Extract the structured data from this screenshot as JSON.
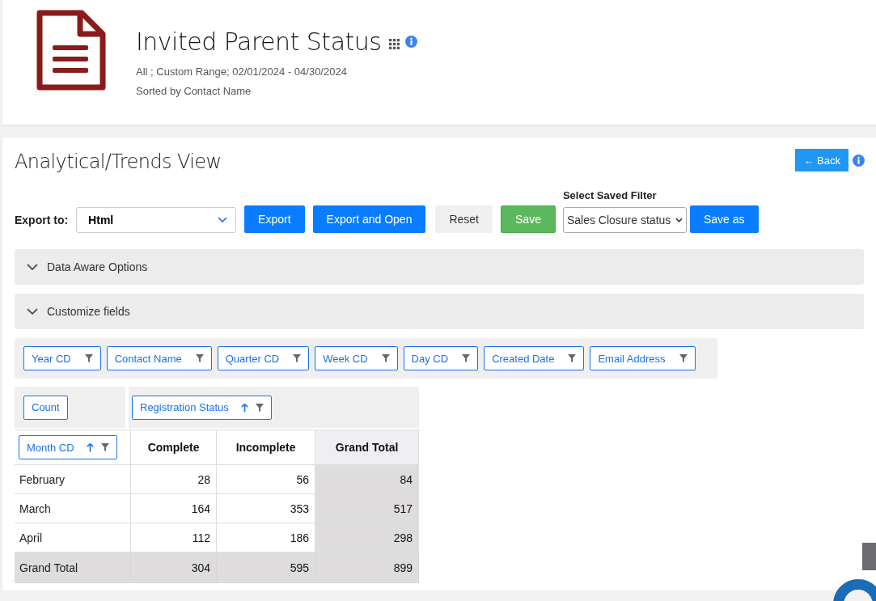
{
  "header": {
    "title": "Invited Parent Status",
    "range": "All ; Custom Range; 02/01/2024 - 04/30/2024",
    "sort_note": "Sorted by Contact Name"
  },
  "view": {
    "title": "Analytical/Trends View",
    "back_button": "← Back"
  },
  "toolbar": {
    "export_label": "Export to:",
    "export_format": "Html",
    "buttons": [
      {
        "label": "Export",
        "kind": "primary"
      },
      {
        "label": "Export and Open",
        "kind": "primary"
      },
      {
        "label": "Reset",
        "kind": "neutral"
      },
      {
        "label": "Save",
        "kind": "success"
      }
    ],
    "saved_filter_label": "Select Saved Filter",
    "saved_filter": "Sales Closure status",
    "save_as": "Save as"
  },
  "panels": [
    {
      "label": "Data Aware Options",
      "expanded": false
    },
    {
      "label": "Customize fields",
      "expanded": false
    }
  ],
  "filter_fields": [
    {
      "label": "Year CD",
      "sorted": false
    },
    {
      "label": "Contact Name",
      "sorted": false
    },
    {
      "label": "Quarter CD",
      "sorted": false
    },
    {
      "label": "Week CD",
      "sorted": false
    },
    {
      "label": "Day CD",
      "sorted": false
    },
    {
      "label": "Created Date",
      "sorted": false
    },
    {
      "label": "Email Address",
      "sorted": false
    }
  ],
  "data_field": "Count",
  "column_field": {
    "label": "Registration Status",
    "sorted": true
  },
  "row_field": {
    "label": "Month CD",
    "sorted": true
  },
  "table": {
    "columns": [
      "Complete",
      "Incomplete",
      "Grand Total"
    ],
    "rows": [
      {
        "label": "February",
        "values": [
          "28",
          "56",
          "84"
        ]
      },
      {
        "label": "March",
        "values": [
          "164",
          "353",
          "517"
        ]
      },
      {
        "label": "April",
        "values": [
          "112",
          "186",
          "298"
        ]
      }
    ],
    "total": {
      "label": "Grand Total",
      "values": [
        "304",
        "595",
        "899"
      ]
    }
  }
}
